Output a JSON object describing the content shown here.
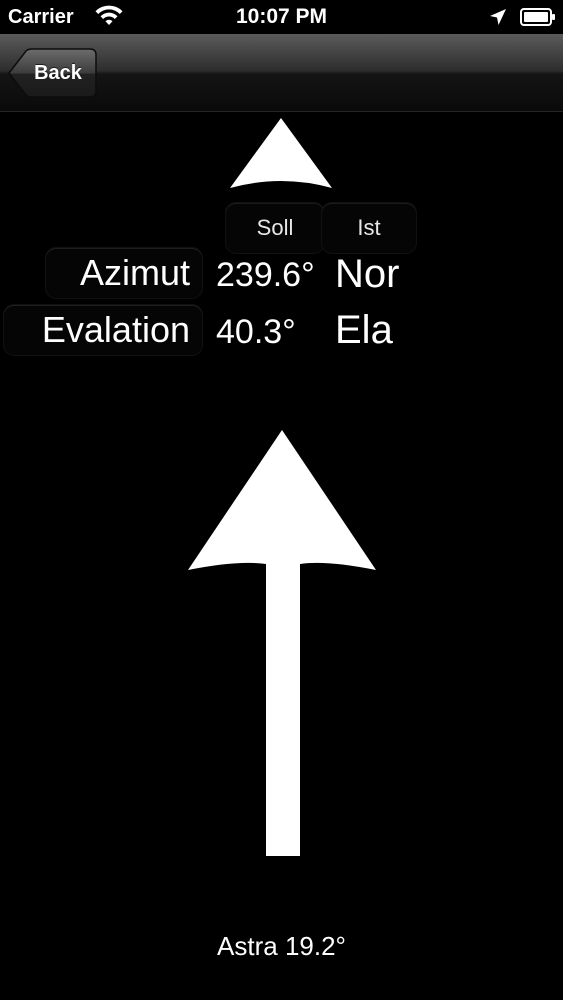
{
  "status_bar": {
    "carrier": "Carrier",
    "time": "10:07 PM",
    "icons": [
      "wifi-icon",
      "location-icon",
      "battery-icon"
    ]
  },
  "nav_bar": {
    "back_label": "Back"
  },
  "table": {
    "headers": {
      "soll": "Soll",
      "ist": "Ist"
    },
    "rows": [
      {
        "label": "Azimut",
        "soll": "239.6°",
        "ist": "Nor"
      },
      {
        "label": "Evalation",
        "soll": "40.3°",
        "ist": "Ela"
      }
    ]
  },
  "footer": {
    "text": "Astra 19.2°"
  },
  "colors": {
    "background": "#000000",
    "foreground": "#ffffff"
  }
}
